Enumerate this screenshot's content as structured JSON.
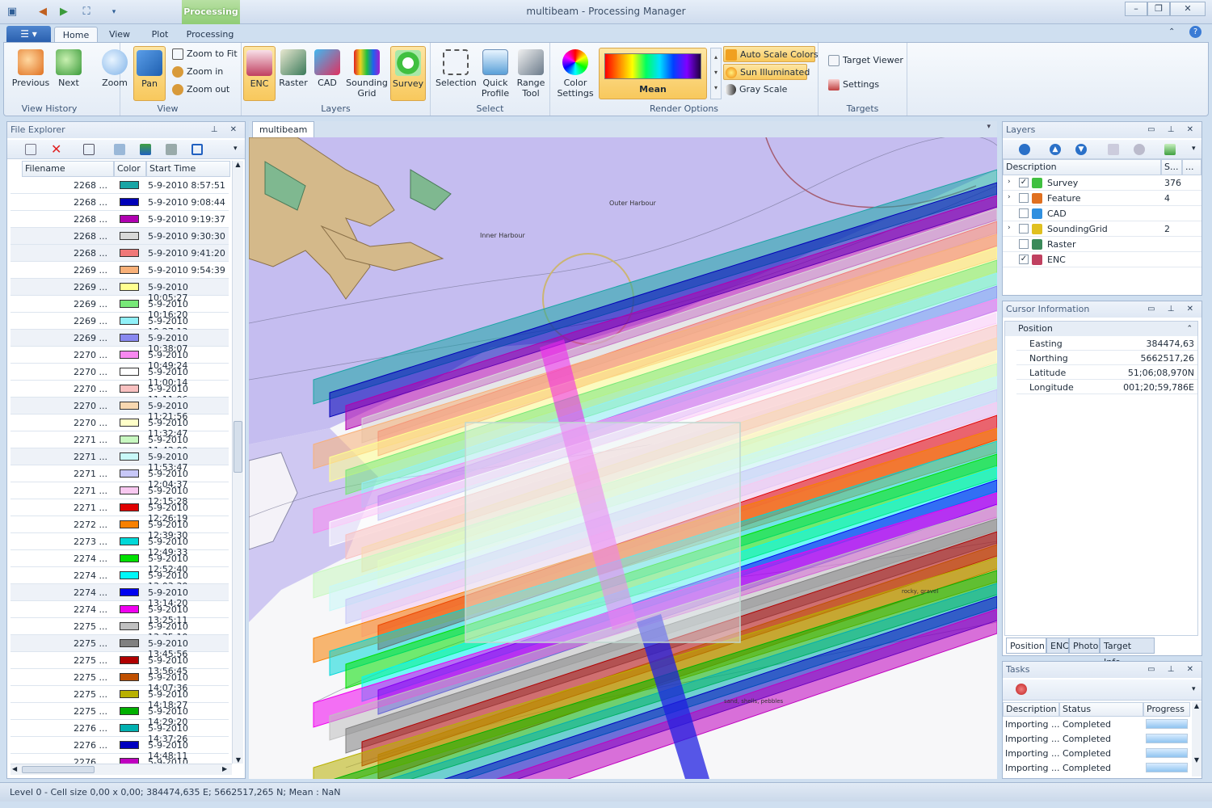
{
  "window": {
    "title": "multibeam  -  Processing Manager",
    "context_tab": "Processing"
  },
  "tabs": [
    {
      "label": "Home"
    },
    {
      "label": "View"
    },
    {
      "label": "Plot"
    },
    {
      "label": "Processing"
    }
  ],
  "ribbon": {
    "view_history": {
      "label": "View History",
      "previous": "Previous",
      "next": "Next"
    },
    "view": {
      "label": "View",
      "zoom": "Zoom",
      "pan": "Pan",
      "zoom_to_fit": "Zoom to Fit",
      "zoom_in": "Zoom in",
      "zoom_out": "Zoom out"
    },
    "layers": {
      "label": "Layers",
      "enc": "ENC",
      "raster": "Raster",
      "cad": "CAD",
      "sounding_grid": "Sounding Grid",
      "survey": "Survey"
    },
    "select": {
      "label": "Select",
      "selection": "Selection",
      "quick_profile": "Quick Profile",
      "range_tool": "Range Tool"
    },
    "render": {
      "label": "Render Options",
      "color_settings": "Color Settings",
      "gradient_label": "Mean",
      "auto_scale": "Auto Scale Colors",
      "sun": "Sun Illuminated",
      "gray": "Gray Scale"
    },
    "targets": {
      "label": "Targets",
      "target_viewer": "Target Viewer",
      "settings": "Settings"
    }
  },
  "file_explorer": {
    "title": "File Explorer",
    "columns": [
      "Filename",
      "Color",
      "Start Time"
    ],
    "rows": [
      {
        "name": "2268 ...",
        "color": "#1aa5a5",
        "time": "5-9-2010 8:57:51"
      },
      {
        "name": "2268 ...",
        "color": "#0000b8",
        "time": "5-9-2010 9:08:44"
      },
      {
        "name": "2268 ...",
        "color": "#b000b0",
        "time": "5-9-2010 9:19:37"
      },
      {
        "name": "2268 ...",
        "color": "#d8d8d8",
        "time": "5-9-2010 9:30:30"
      },
      {
        "name": "2268 ...",
        "color": "#f07878",
        "time": "5-9-2010 9:41:20"
      },
      {
        "name": "2269 ...",
        "color": "#f8b078",
        "time": "5-9-2010 9:54:39"
      },
      {
        "name": "2269 ...",
        "color": "#ffff90",
        "time": "5-9-2010 10:05:27"
      },
      {
        "name": "2269 ...",
        "color": "#78e878",
        "time": "5-9-2010 10:16:20"
      },
      {
        "name": "2269 ...",
        "color": "#90f0f8",
        "time": "5-9-2010 10:27:13"
      },
      {
        "name": "2269 ...",
        "color": "#8888f0",
        "time": "5-9-2010 10:38:07"
      },
      {
        "name": "2270 ...",
        "color": "#f888f0",
        "time": "5-9-2010 10:49:24"
      },
      {
        "name": "2270 ...",
        "color": "#ffffff",
        "time": "5-9-2010 11:00:14"
      },
      {
        "name": "2270 ...",
        "color": "#f8c0c0",
        "time": "5-9-2010 11:11:06"
      },
      {
        "name": "2270 ...",
        "color": "#f8d8b0",
        "time": "5-9-2010 11:21:56"
      },
      {
        "name": "2270 ...",
        "color": "#ffffc8",
        "time": "5-9-2010 11:32:47"
      },
      {
        "name": "2271 ...",
        "color": "#c8f8c0",
        "time": "5-9-2010 11:43:00"
      },
      {
        "name": "2271 ...",
        "color": "#c8f8f8",
        "time": "5-9-2010 11:53:47"
      },
      {
        "name": "2271 ...",
        "color": "#c8c8f8",
        "time": "5-9-2010 12:04:37"
      },
      {
        "name": "2271 ...",
        "color": "#f8c8f0",
        "time": "5-9-2010 12:15:28"
      },
      {
        "name": "2271 ...",
        "color": "#e00000",
        "time": "5-9-2010 12:26:19"
      },
      {
        "name": "2272 ...",
        "color": "#f88000",
        "time": "5-9-2010 12:39:30"
      },
      {
        "name": "2273 ...",
        "color": "#00d8d8",
        "time": "5-9-2010 12:49:33"
      },
      {
        "name": "2274 ...",
        "color": "#00e000",
        "time": "5-9-2010 12:52:40"
      },
      {
        "name": "2274 ...",
        "color": "#00f8f8",
        "time": "5-9-2010 13:03:30"
      },
      {
        "name": "2274 ...",
        "color": "#0000f0",
        "time": "5-9-2010 13:14:20"
      },
      {
        "name": "2274 ...",
        "color": "#f000f0",
        "time": "5-9-2010 13:25:11"
      },
      {
        "name": "2275 ...",
        "color": "#c0c0c0",
        "time": "5-9-2010 13:35:10"
      },
      {
        "name": "2275 ...",
        "color": "#808080",
        "time": "5-9-2010 13:45:56"
      },
      {
        "name": "2275 ...",
        "color": "#b00000",
        "time": "5-9-2010 13:56:45"
      },
      {
        "name": "2275 ...",
        "color": "#c05000",
        "time": "5-9-2010 14:07:36"
      },
      {
        "name": "2275 ...",
        "color": "#b8b000",
        "time": "5-9-2010 14:18:27"
      },
      {
        "name": "2275 ...",
        "color": "#00b000",
        "time": "5-9-2010 14:29:20"
      },
      {
        "name": "2276 ...",
        "color": "#00b0b0",
        "time": "5-9-2010 14:37:26"
      },
      {
        "name": "2276 ...",
        "color": "#0000c0",
        "time": "5-9-2010 14:48:11"
      },
      {
        "name": "2276 ...",
        "color": "#c000c0",
        "time": "5-9-2010 14:59:04"
      }
    ]
  },
  "document": {
    "tab": "multibeam",
    "labels": {
      "outer_harbour": "Outer Harbour",
      "inner_harbour": "Inner Harbour",
      "rocky": "rocky, gravel",
      "sand": "sand, shells, pebbles"
    }
  },
  "layers": {
    "title": "Layers",
    "columns": [
      "Description",
      "S...",
      "..."
    ],
    "rows": [
      {
        "name": "Survey",
        "checked": true,
        "count": "376",
        "expand": true
      },
      {
        "name": "Feature",
        "checked": false,
        "count": "4",
        "expand": true
      },
      {
        "name": "CAD",
        "checked": false,
        "count": "",
        "expand": false
      },
      {
        "name": "SoundingGrid",
        "checked": false,
        "count": "2",
        "expand": true
      },
      {
        "name": "Raster",
        "checked": false,
        "count": "",
        "expand": false
      },
      {
        "name": "ENC",
        "checked": true,
        "count": "",
        "expand": false
      }
    ]
  },
  "cursor_info": {
    "title": "Cursor Information",
    "section": "Position",
    "rows": [
      {
        "k": "Easting",
        "v": "384474,63"
      },
      {
        "k": "Northing",
        "v": "5662517,26"
      },
      {
        "k": "Latitude",
        "v": "51;06;08,970N"
      },
      {
        "k": "Longitude",
        "v": "001;20;59,786E"
      }
    ],
    "tabs": [
      "Position",
      "ENC",
      "Photo",
      "Target Info"
    ]
  },
  "tasks": {
    "title": "Tasks",
    "columns": [
      "Description",
      "Status",
      "Progress"
    ],
    "rows": [
      {
        "d": "Importing ...",
        "s": "Completed",
        "p": 1
      },
      {
        "d": "Importing ...",
        "s": "Completed",
        "p": 1
      },
      {
        "d": "Importing ...",
        "s": "Completed",
        "p": 1
      },
      {
        "d": "Importing ...",
        "s": "Completed",
        "p": 1
      }
    ]
  },
  "status": "Level 0 - Cell size 0,00 x 0,00; 384474,635 E; 5662517,265 N; Mean : NaN"
}
